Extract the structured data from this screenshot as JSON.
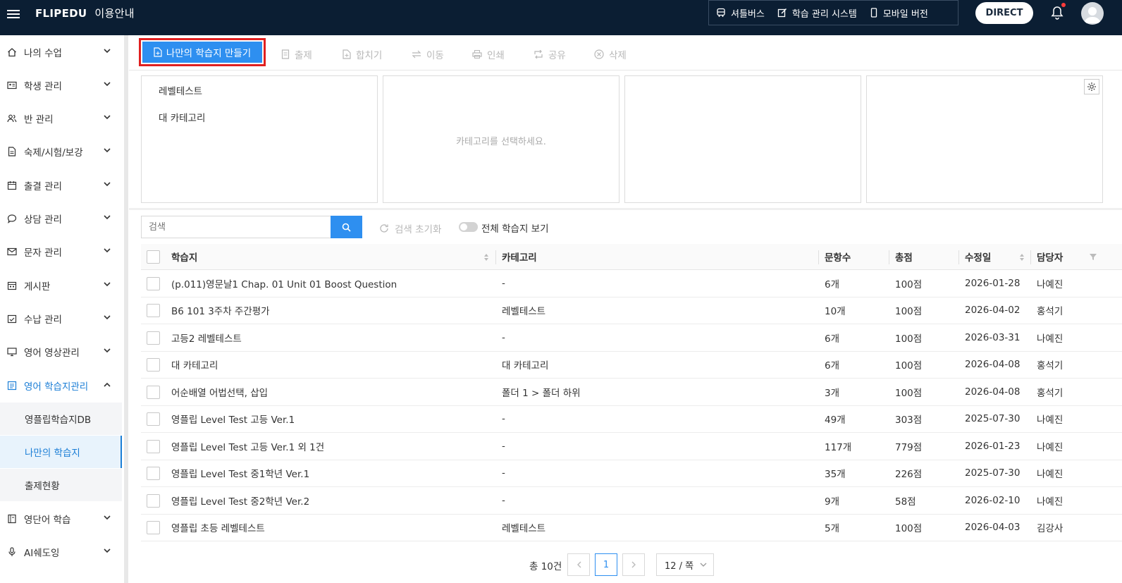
{
  "header": {
    "brand": "FLIPEDU",
    "brand_suffix": "이용안내",
    "nav": [
      "셔틀버스",
      "학습 관리 시스템",
      "모바일 버전"
    ],
    "direct": "DIRECT"
  },
  "sidebar": {
    "items": [
      {
        "label": "나의 수업",
        "icon": "home-icon"
      },
      {
        "label": "학생 관리",
        "icon": "id-card-icon"
      },
      {
        "label": "반 관리",
        "icon": "users-icon"
      },
      {
        "label": "숙제/시험/보강",
        "icon": "document-icon"
      },
      {
        "label": "출결 관리",
        "icon": "calendar-icon"
      },
      {
        "label": "상담 관리",
        "icon": "chat-icon"
      },
      {
        "label": "문자 관리",
        "icon": "mail-icon"
      },
      {
        "label": "게시판",
        "icon": "board-icon"
      },
      {
        "label": "수납 관리",
        "icon": "payment-icon"
      },
      {
        "label": "영어 영상관리",
        "icon": "monitor-icon"
      },
      {
        "label": "영어 학습지관리",
        "icon": "worksheet-icon"
      },
      {
        "label": "영단어 학습",
        "icon": "book-icon"
      },
      {
        "label": "AI쉐도잉",
        "icon": "mic-icon"
      }
    ],
    "subitems": [
      "영플립학습지DB",
      "나만의 학습지",
      "출제현황"
    ]
  },
  "toolbar": {
    "create": "나만의 학습지 만들기",
    "tools": [
      "출제",
      "합치기",
      "이동",
      "인쇄",
      "공유",
      "삭제"
    ]
  },
  "categories": {
    "col1": [
      "레벨테스트",
      "대 카테고리"
    ],
    "placeholder": "카테고리를 선택하세요."
  },
  "search": {
    "placeholder": "검색",
    "reset": "검색 초기화",
    "toggle_label": "전체 학습지 보기"
  },
  "table": {
    "headers": [
      "학습지",
      "카테고리",
      "문항수",
      "총점",
      "수정일",
      "담당자"
    ],
    "rows": [
      [
        "(p.011)영문날1 Chap. 01 Unit 01 Boost Question",
        "-",
        "6개",
        "100점",
        "2026-01-28",
        "나예진"
      ],
      [
        "B6 101 3주차 주간평가",
        "레벨테스트",
        "10개",
        "100점",
        "2026-04-02",
        "홍석기"
      ],
      [
        "고등2 레벨테스트",
        "-",
        "6개",
        "100점",
        "2026-03-31",
        "나예진"
      ],
      [
        "대 카테고리",
        "대 카테고리",
        "6개",
        "100점",
        "2026-04-08",
        "홍석기"
      ],
      [
        "어순배열 어법선택, 삽입",
        "폴더 1 > 폴더 하위",
        "3개",
        "100점",
        "2026-04-08",
        "홍석기"
      ],
      [
        "영플립 Level Test 고등 Ver.1",
        "-",
        "49개",
        "303점",
        "2025-07-30",
        "나예진"
      ],
      [
        "영플립 Level Test 고등 Ver.1 외 1건",
        "-",
        "117개",
        "779점",
        "2026-01-23",
        "나예진"
      ],
      [
        "영플립 Level Test 중1학년 Ver.1",
        "-",
        "35개",
        "226점",
        "2025-07-30",
        "나예진"
      ],
      [
        "영플립 Level Test 중2학년 Ver.2",
        "-",
        "9개",
        "58점",
        "2026-02-10",
        "나예진"
      ],
      [
        "영플립 초등 레벨테스트",
        "레벨테스트",
        "5개",
        "100점",
        "2026-04-03",
        "김강사"
      ]
    ]
  },
  "pagination": {
    "total": "총 10건",
    "current": "1",
    "page_size": "12 / 쪽"
  },
  "colors": {
    "header_bg": "#0b1e33",
    "accent": "#2e8ff0",
    "highlight": "#e02020"
  }
}
